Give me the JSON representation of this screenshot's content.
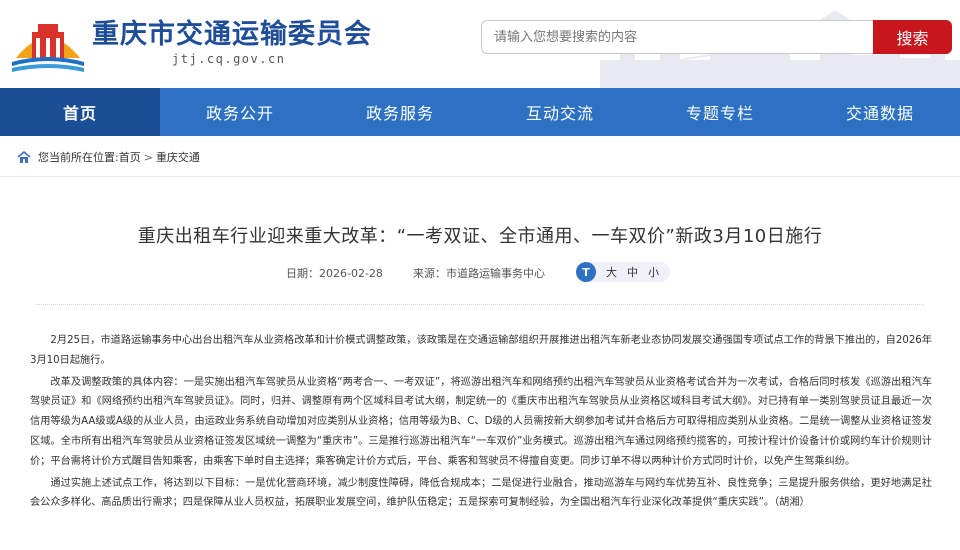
{
  "header": {
    "site_name": "重庆市交通运输委员会",
    "site_domain": "jtj.cq.gov.cn",
    "search": {
      "placeholder": "请输入您想要搜索的内容",
      "button_label": "搜索"
    },
    "colors": {
      "brand_blue": "#1f4e99",
      "search_red": "#c8161d"
    }
  },
  "nav": {
    "items": [
      {
        "label": "首页",
        "active": true
      },
      {
        "label": "政务公开"
      },
      {
        "label": "政务服务"
      },
      {
        "label": "互动交流"
      },
      {
        "label": "专题专栏"
      },
      {
        "label": "交通数据"
      }
    ],
    "colors": {
      "bar": "#2d71c2",
      "active": "#1a4f95"
    }
  },
  "breadcrumb": {
    "prefix": "您当前所在位置:",
    "home": "首页",
    "separator": ">",
    "current": "重庆交通"
  },
  "article": {
    "title": "重庆出租车行业迎来重大改革：“一考双证、全市通用、一车双价”新政3月10日施行",
    "date_label": "日期：",
    "date": "2026-02-28",
    "source_label": "来源：",
    "source": "市道路运输事务中心",
    "font_sizes": [
      "大",
      "中",
      "小"
    ],
    "paragraphs": [
      "2月25日，市道路运输事务中心出台出租汽车从业资格改革和计价模式调整政策，该政策是在交通运输部组织开展推进出租汽车新老业态协同发展交通强国专项试点工作的背景下推出的，自2026年3月10日起施行。",
      "改革及调整政策的具体内容：一是实施出租汽车驾驶员从业资格“两考合一、一考双证”，将巡游出租汽车和网络预约出租汽车驾驶员从业资格考试合并为一次考试，合格后同时核发《巡游出租汽车驾驶员证》和《网络预约出租汽车驾驶员证》。同时，归并、调整原有两个区域科目考试大纲，制定统一的《重庆市出租汽车驾驶员从业资格区域科目考试大纲》。对已持有单一类别驾驶员证且最近一次信用等级为AA级或A级的从业人员，由运政业务系统自动增加对应类别从业资格；信用等级为B、C、D级的人员需按新大纲参加考试并合格后方可取得相应类别从业资格。二是统一调整从业资格证签发区域。全市所有出租汽车驾驶员从业资格证签发区域统一调整为“重庆市”。三是推行巡游出租汽车“一车双价”业务模式。巡游出租汽车通过网络预约揽客的，可按计程计价设备计价或网约车计价规则计价；平台需将计价方式醒目告知乘客，由乘客下单时自主选择；乘客确定计价方式后，平台、乘客和驾驶员不得擅自变更。同步订单不得以两种计价方式同时计价，以免产生驾乘纠纷。",
      "通过实施上述试点工作，将达到以下目标：一是优化营商环境，减少制度性障碍，降低合规成本；二是促进行业融合，推动巡游车与网约车优势互补、良性竞争；三是提升服务供给，更好地满足社会公众多样化、高品质出行需求；四是保障从业人员权益，拓展职业发展空间，维护队伍稳定；五是探索可复制经验，为全国出租汽车行业深化改革提供“重庆实践”。（胡湘）"
    ]
  }
}
